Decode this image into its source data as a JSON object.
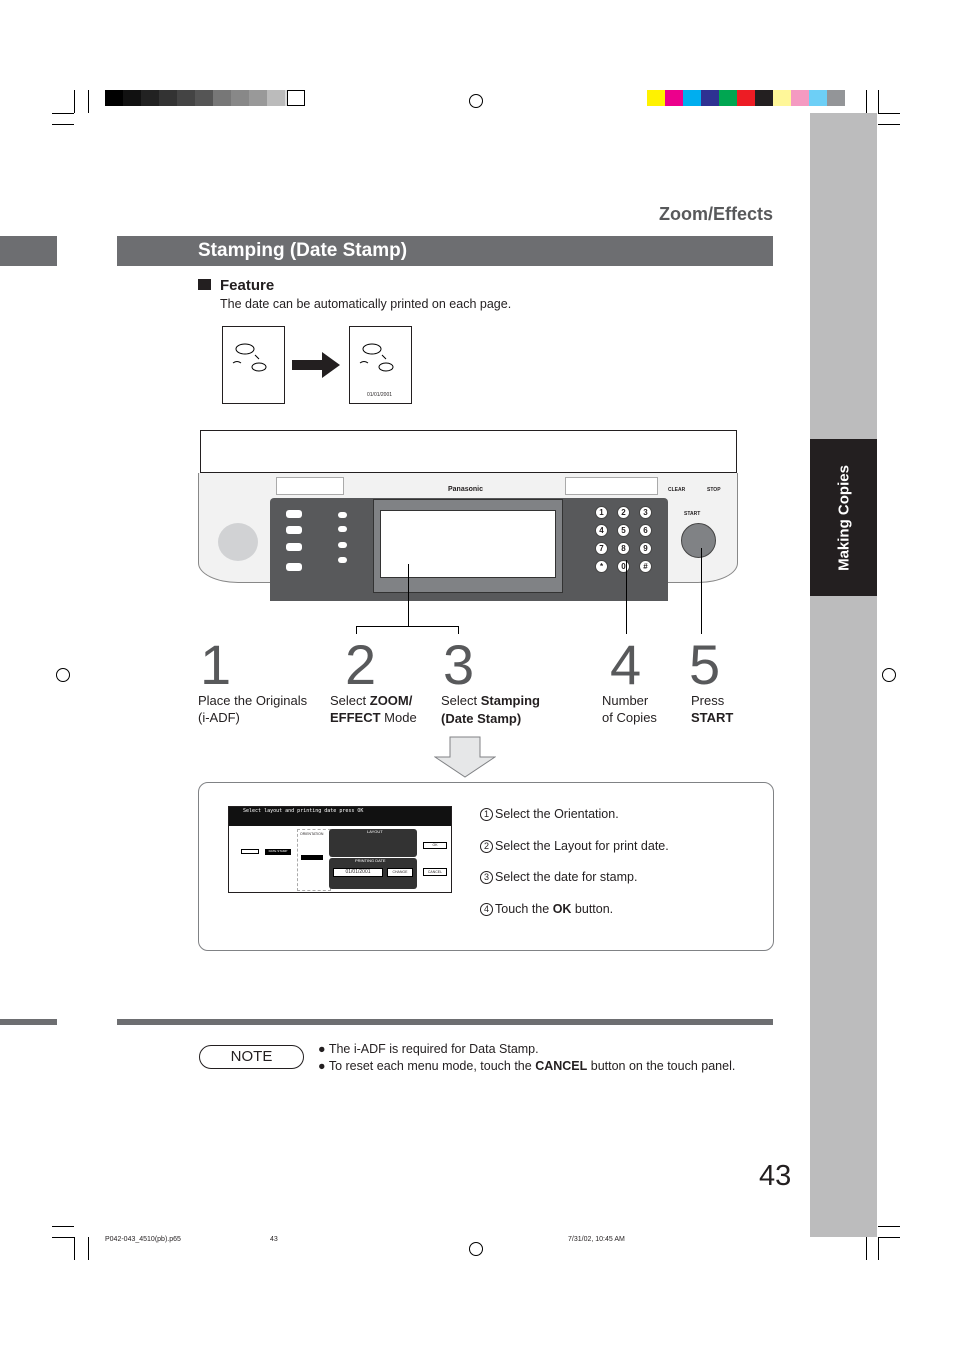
{
  "header": {
    "section": "Zoom/Effects",
    "title": "Stamping (Date Stamp)"
  },
  "sidebar": {
    "tab": "Making Copies"
  },
  "feature": {
    "heading": "Feature",
    "description": "The date can be automatically printed on each page.",
    "stamp_date": "01/01/2001"
  },
  "panel": {
    "brand": "Panasonic",
    "start_label": "START",
    "clear_label": "CLEAR",
    "stop_label": "STOP",
    "keys": [
      "1",
      "2",
      "3",
      "4",
      "5",
      "6",
      "7",
      "8",
      "9",
      "*",
      "0",
      "#"
    ]
  },
  "steps": [
    {
      "num": "1",
      "line1": "Place the Originals",
      "line2": "(i-ADF)",
      "bold": ""
    },
    {
      "num": "2",
      "line1": "Select ",
      "bold1": "ZOOM/",
      "bold2": "EFFECT",
      "line2": " Mode"
    },
    {
      "num": "3",
      "line1": "Select ",
      "bold1": "Stamping",
      "bold2": "(Date Stamp)"
    },
    {
      "num": "4",
      "line1": "Number",
      "line2": "of Copies"
    },
    {
      "num": "5",
      "line1": "Press",
      "bold2": "START"
    }
  ],
  "touch_panel": {
    "message": "Select layout and printing date press OK",
    "orientation": "ORIENTATION",
    "layout": "LAYOUT",
    "printing_date": "PRINTING DATE",
    "date": "01/01/2001",
    "change": "CHANGE",
    "ok": "OK",
    "cancel": "CANCEL",
    "date_stamp": "DATE STAMP"
  },
  "instructions": [
    {
      "n": "1",
      "text": "Select the Orientation."
    },
    {
      "n": "2",
      "text": "Select the Layout for print date."
    },
    {
      "n": "3",
      "text": "Select the date for stamp."
    },
    {
      "n": "4",
      "pre": "Touch the ",
      "bold": "OK",
      "post": " button."
    }
  ],
  "note": {
    "label": "NOTE",
    "items": [
      {
        "pre": "The i-ADF is required for Data Stamp.",
        "bold": "",
        "post": ""
      },
      {
        "pre": "To reset each menu mode, touch the ",
        "bold": "CANCEL",
        "post": " button on the touch panel."
      }
    ]
  },
  "page_number": "43",
  "footer": {
    "file": "P042-043_4510(pb).p65",
    "page": "43",
    "datetime": "7/31/02, 10:45 AM"
  },
  "colors": {
    "section_bar": "#6d6e71",
    "sidebar": "#bcbcbd",
    "sidetab": "#231f20"
  }
}
